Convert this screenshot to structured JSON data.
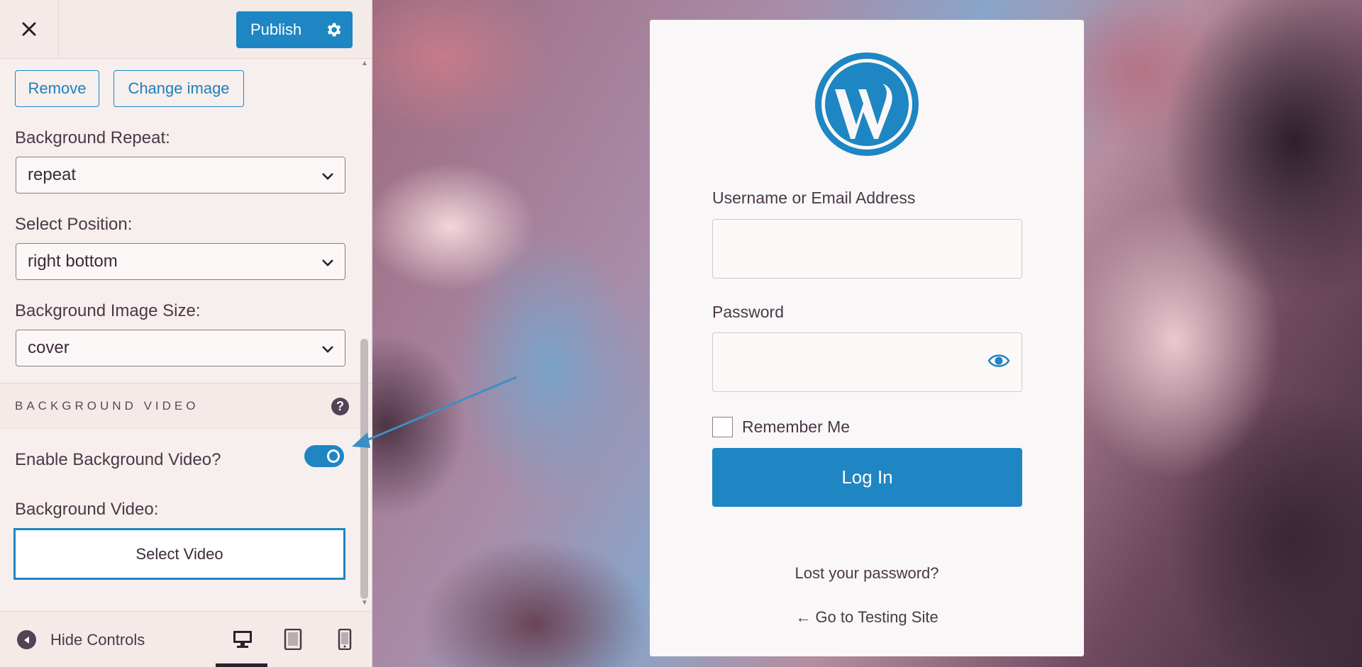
{
  "sidebar": {
    "publish_label": "Publish",
    "remove_label": "Remove",
    "change_image_label": "Change image",
    "bg_repeat": {
      "label": "Background Repeat:",
      "value": "repeat"
    },
    "select_position": {
      "label": "Select Position:",
      "value": "right bottom"
    },
    "bg_image_size": {
      "label": "Background Image Size:",
      "value": "cover"
    },
    "bg_video_section_title": "BACKGROUND VIDEO",
    "help_symbol": "?",
    "enable_video": {
      "label": "Enable Background Video?",
      "enabled": true
    },
    "bg_video_label": "Background Video:",
    "select_video_label": "Select Video",
    "hide_controls_label": "Hide Controls",
    "devices": [
      "desktop",
      "tablet",
      "mobile"
    ],
    "active_device": "desktop"
  },
  "login": {
    "username_label": "Username or Email Address",
    "password_label": "Password",
    "remember_label": "Remember Me",
    "login_button": "Log In",
    "lost_password": "Lost your password?",
    "back_link": "← Go to Testing Site"
  },
  "colors": {
    "accent": "#1d86c3",
    "sidebar_bg": "#f7efed",
    "text_dark": "#4b3848"
  }
}
